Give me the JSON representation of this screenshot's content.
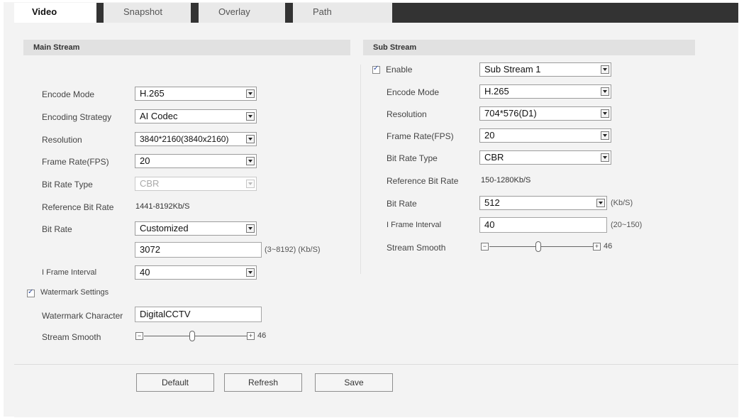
{
  "tabs": [
    {
      "label": "Video"
    },
    {
      "label": "Snapshot"
    },
    {
      "label": "Overlay"
    },
    {
      "label": "Path"
    }
  ],
  "main_stream": {
    "title": "Main Stream",
    "encode_mode": {
      "label": "Encode Mode",
      "value": "H.265"
    },
    "encoding_strategy": {
      "label": "Encoding Strategy",
      "value": "AI Codec"
    },
    "resolution": {
      "label": "Resolution",
      "value": "3840*2160(3840x2160)"
    },
    "frame_rate": {
      "label": "Frame Rate(FPS)",
      "value": "20"
    },
    "bit_rate_type": {
      "label": "Bit Rate Type",
      "value": "CBR"
    },
    "reference_bit_rate": {
      "label": "Reference Bit Rate",
      "value": "1441-8192Kb/S"
    },
    "bit_rate": {
      "label": "Bit Rate",
      "value": "Customized",
      "custom_value": "3072",
      "range": "(3~8192) (Kb/S)"
    },
    "i_frame_interval": {
      "label": "I Frame Interval",
      "value": "40"
    },
    "watermark": {
      "label": "Watermark Settings",
      "checked": true
    },
    "watermark_character": {
      "label": "Watermark Character",
      "value": "DigitalCCTV"
    },
    "stream_smooth": {
      "label": "Stream Smooth",
      "value": "46"
    }
  },
  "sub_stream": {
    "title": "Sub Stream",
    "enable": {
      "label": "Enable",
      "checked": true,
      "value": "Sub Stream 1"
    },
    "encode_mode": {
      "label": "Encode Mode",
      "value": "H.265"
    },
    "resolution": {
      "label": "Resolution",
      "value": "704*576(D1)"
    },
    "frame_rate": {
      "label": "Frame Rate(FPS)",
      "value": "20"
    },
    "bit_rate_type": {
      "label": "Bit Rate Type",
      "value": "CBR"
    },
    "reference_bit_rate": {
      "label": "Reference Bit Rate",
      "value": "150-1280Kb/S"
    },
    "bit_rate": {
      "label": "Bit Rate",
      "value": "512",
      "unit": "(Kb/S)"
    },
    "i_frame_interval": {
      "label": "I Frame Interval",
      "value": "40",
      "range": "(20~150)"
    },
    "stream_smooth": {
      "label": "Stream Smooth",
      "value": "46"
    }
  },
  "buttons": {
    "default": "Default",
    "refresh": "Refresh",
    "save": "Save"
  },
  "colors": {
    "tabbar": "#333333",
    "section_header": "#e1e1e1",
    "background": "#f3f3f3"
  }
}
